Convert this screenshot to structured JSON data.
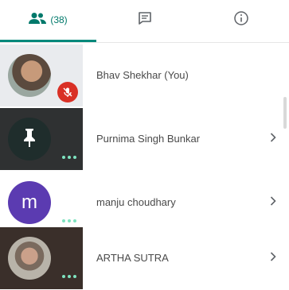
{
  "tabs": {
    "people": {
      "icon": "people-icon",
      "count": "(38)"
    },
    "chat": {
      "icon": "chat-icon"
    },
    "info": {
      "icon": "info-icon"
    }
  },
  "participants": [
    {
      "name": "Bhav Shekhar (You)",
      "avatar": "photo",
      "status": "muted-mic-icon"
    },
    {
      "name": "Purnima Singh Bunkar",
      "avatar": "pin-icon",
      "status": "more-dots"
    },
    {
      "name": "manju choudhary",
      "avatar_initial": "m",
      "status": "more-dots"
    },
    {
      "name": "ARTHA SUTRA",
      "avatar": "photo",
      "status": "more-dots"
    }
  ],
  "colors": {
    "accent": "#00897b",
    "muted_badge": "#d93025",
    "initial_avatar": "#5b3bb1",
    "dots": "#7ee3c0"
  }
}
